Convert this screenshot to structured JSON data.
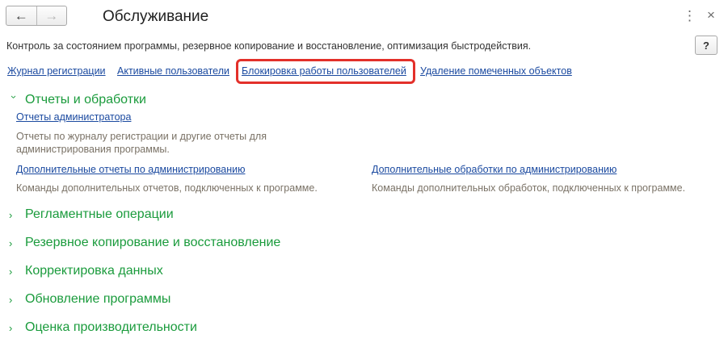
{
  "window": {
    "title": "Обслуживание",
    "back_icon": "←",
    "forward_icon": "→",
    "more_icon": "⋮",
    "close_icon": "×"
  },
  "description": "Контроль за состоянием программы, резервное копирование и восстановление, оптимизация быстродействия.",
  "help_label": "?",
  "top_links": [
    "Журнал регистрации",
    "Активные пользователи",
    "Блокировка работы пользователей",
    "Удаление помеченных объектов"
  ],
  "highlight_color": "#e3302a",
  "accent_color": "#1a9b3c",
  "link_color": "#1b4aa0",
  "sections": {
    "reports": {
      "title": "Отчеты и обработки",
      "admin_reports_link": "Отчеты администратора",
      "admin_reports_desc_line1": "Отчеты по журналу регистрации и другие отчеты для",
      "admin_reports_desc_line2": "администрирования программы.",
      "extra_reports_link": "Дополнительные отчеты по администрированию",
      "extra_reports_desc": "Команды дополнительных отчетов, подключенных к программе.",
      "extra_processing_link": "Дополнительные обработки по администрированию",
      "extra_processing_desc": "Команды дополнительных обработок, подключенных к программе."
    },
    "collapsed": [
      "Регламентные операции",
      "Резервное копирование и восстановление",
      "Корректировка данных",
      "Обновление программы",
      "Оценка производительности"
    ]
  },
  "chevron_icon": "›"
}
